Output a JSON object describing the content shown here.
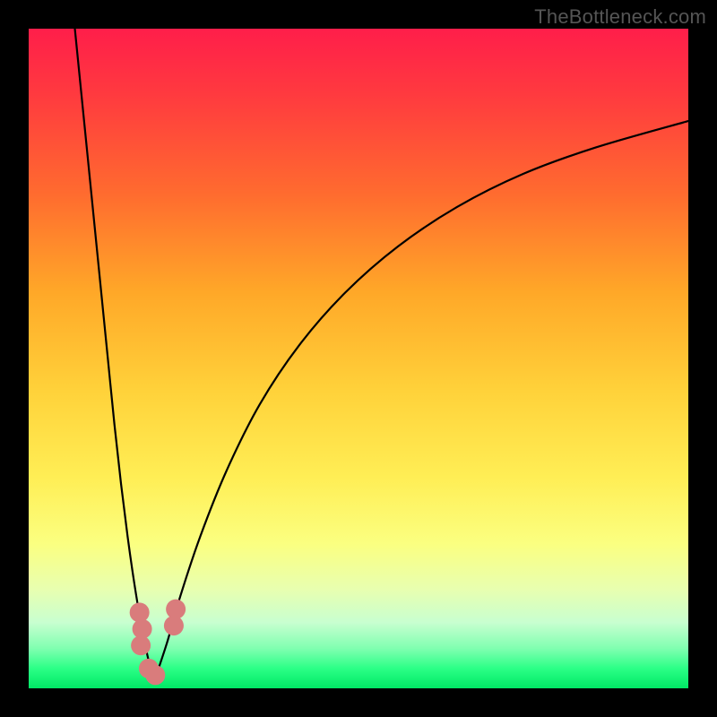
{
  "watermark": "TheBottleneck.com",
  "colors": {
    "frame": "#000000",
    "watermark": "#555555",
    "curve": "#000000",
    "dot": "#d97c7c",
    "gradient_top": "#ff1e4a",
    "gradient_bottom": "#00e865"
  },
  "chart_data": {
    "type": "line",
    "title": "",
    "xlabel": "",
    "ylabel": "",
    "xlim": [
      0,
      100
    ],
    "ylim": [
      0,
      100
    ],
    "note": "Axes are unlabeled; values are in percent of plot width/height, y=0 at bottom. Two V-shaped curves with minimum near x≈19; right branch rises gradually toward top-right.",
    "series": [
      {
        "name": "left-branch",
        "x": [
          7,
          8,
          9,
          10,
          11,
          12,
          13,
          14,
          15,
          16,
          17,
          18,
          19
        ],
        "y": [
          100,
          90,
          80,
          70,
          60,
          50,
          40,
          31,
          23,
          16,
          10,
          5,
          1
        ]
      },
      {
        "name": "right-branch",
        "x": [
          19,
          21,
          23,
          26,
          30,
          35,
          41,
          48,
          56,
          65,
          75,
          86,
          100
        ],
        "y": [
          1,
          7,
          14,
          23,
          33,
          43,
          52,
          60,
          67,
          73,
          78,
          82,
          86
        ]
      }
    ],
    "scatter_points": {
      "name": "marker-cluster",
      "x": [
        16.8,
        17.2,
        17.0,
        18.2,
        19.2,
        22.0,
        22.3
      ],
      "y": [
        11.5,
        9.0,
        6.5,
        3.0,
        2.0,
        9.5,
        12.0
      ]
    }
  }
}
